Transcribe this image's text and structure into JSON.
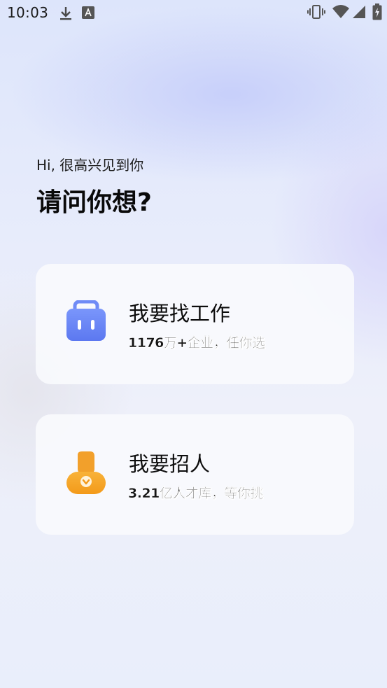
{
  "status_bar": {
    "time": "10:03",
    "icons": [
      "download-icon",
      "text-a-icon",
      "vibrate-icon",
      "wifi-icon",
      "signal-icon",
      "battery-icon"
    ]
  },
  "header": {
    "greeting": "Hi, 很高兴见到你",
    "question": "请问你想?"
  },
  "options": [
    {
      "title": "我要找工作",
      "subtitle": "1176万+企业，任你选",
      "icon": "briefcase-icon",
      "icon_color": "#6b87f5"
    },
    {
      "title": "我要招人",
      "subtitle": "3.21亿人才库，等你挑",
      "icon": "recruiter-person-icon",
      "icon_color": "#f6a623"
    }
  ],
  "colors": {
    "background": "#e6ebfb",
    "card": "#f9fafd",
    "primary_blue": "#6b87f5",
    "accent_orange": "#f6a623"
  }
}
